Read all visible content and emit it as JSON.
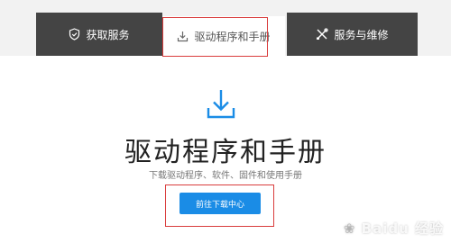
{
  "tabs": {
    "get_service": {
      "label": "获取服务",
      "icon": "shield-check-icon"
    },
    "drivers": {
      "label": "驱动程序和手册",
      "icon": "download-icon"
    },
    "repair": {
      "label": "服务与维修",
      "icon": "tools-icon"
    }
  },
  "hero": {
    "icon": "download-icon",
    "title": "驱动程序和手册",
    "subtitle": "下载驱动程序、软件、固件和使用手册",
    "cta_label": "前往下载中心"
  },
  "watermark": {
    "text": "Baidu 经验"
  },
  "colors": {
    "tab_dark": "#444444",
    "accent_blue": "#1a8ce6",
    "highlight_red": "#d93c3c"
  }
}
